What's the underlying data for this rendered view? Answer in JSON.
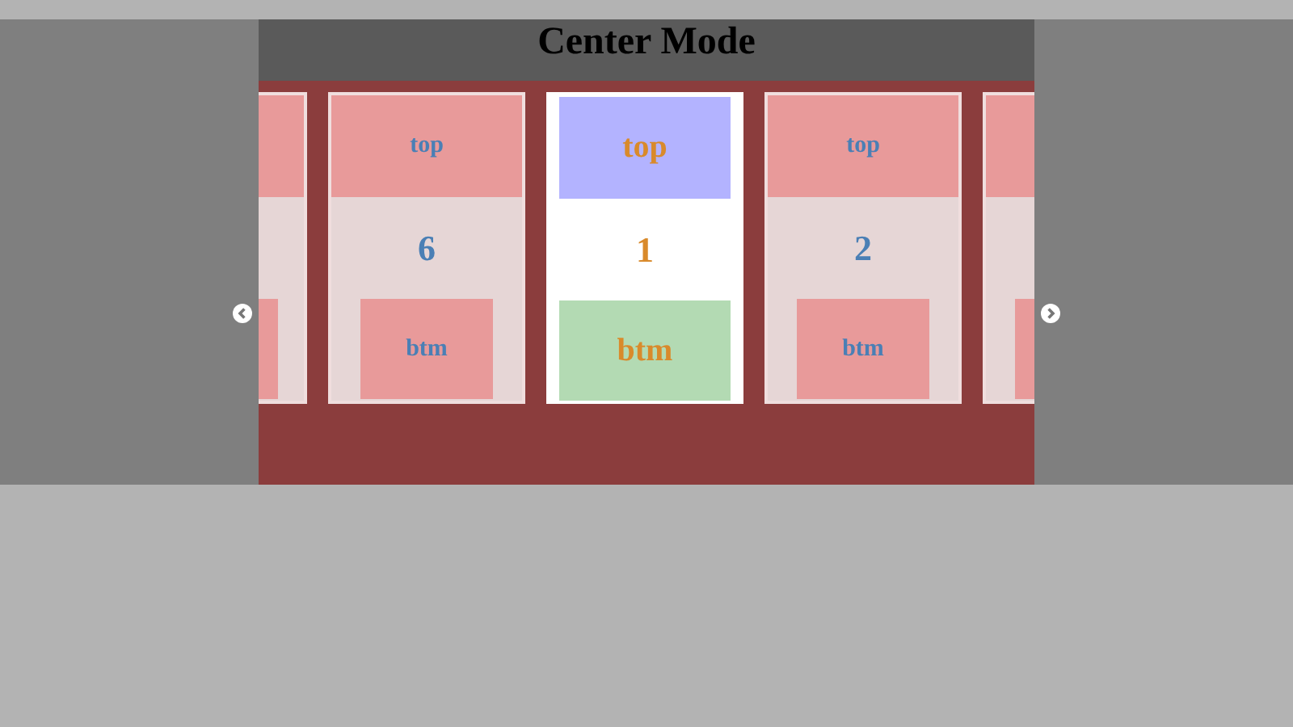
{
  "title": "Center Mode",
  "slides": [
    {
      "kind": "partial",
      "selected": false
    },
    {
      "kind": "full",
      "selected": false,
      "top": "top",
      "number": "6",
      "bottom": "btm"
    },
    {
      "kind": "full",
      "selected": true,
      "top": "top",
      "number": "1",
      "bottom": "btm"
    },
    {
      "kind": "full",
      "selected": false,
      "top": "top",
      "number": "2",
      "bottom": "btm"
    },
    {
      "kind": "partial",
      "selected": false
    }
  ]
}
